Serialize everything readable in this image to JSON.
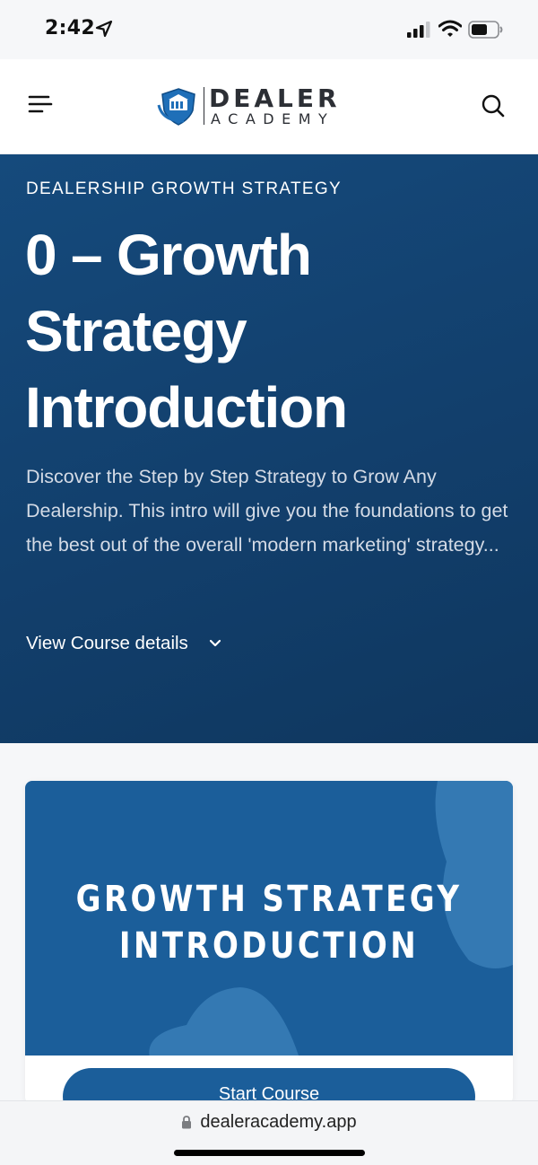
{
  "status_bar": {
    "time": "2:42",
    "icons": [
      "location-arrow-icon",
      "cellular-signal-icon",
      "wifi-icon",
      "battery-icon"
    ]
  },
  "header": {
    "logo_line_1": "DEALER",
    "logo_line_2": "ACADEMY",
    "menu_icon": "hamburger-menu-icon",
    "search_icon": "search-icon"
  },
  "hero": {
    "kicker": "DEALERSHIP GROWTH STRATEGY",
    "title": "0 – Growth Strategy Introduction",
    "description": "Discover the Step by Step Strategy to Grow Any Dealership. This intro will give you the foundations to get the best out of the overall 'modern marketing' strategy...",
    "details_toggle_label": "View Course details"
  },
  "course_card": {
    "banner_line_1": "GROWTH STRATEGY",
    "banner_line_2": "INTRODUCTION",
    "start_button_label": "Start Course"
  },
  "browser": {
    "url": "dealeracademy.app"
  },
  "colors": {
    "hero_bg": "#123f6c",
    "card_banner": "#1b5e9a",
    "button": "#1b5e9a",
    "logo_blue": "#1f6fb8"
  }
}
